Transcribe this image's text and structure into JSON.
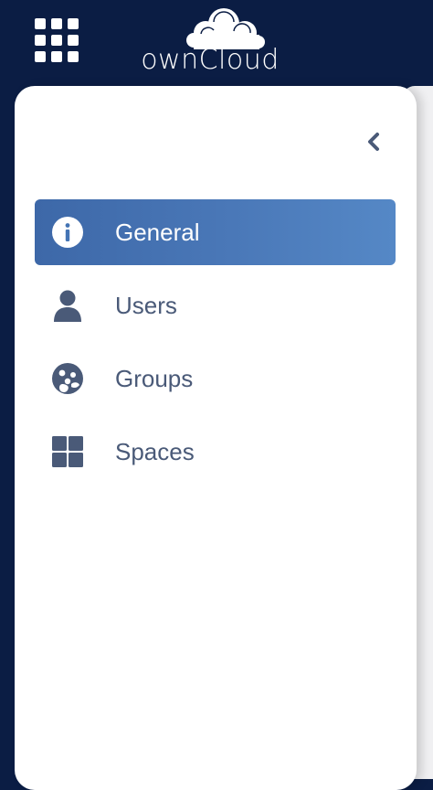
{
  "header": {
    "logo_text": "ownCloud"
  },
  "sidebar": {
    "items": [
      {
        "label": "General",
        "icon": "info-icon",
        "active": true
      },
      {
        "label": "Users",
        "icon": "user-icon",
        "active": false
      },
      {
        "label": "Groups",
        "icon": "group-icon",
        "active": false
      },
      {
        "label": "Spaces",
        "icon": "spaces-grid-icon",
        "active": false
      }
    ]
  },
  "colors": {
    "topbar_bg": "#0b1d44",
    "active_item": "#4a78b8",
    "item_text": "#4a5a78",
    "icon_fill": "#4a5a78"
  }
}
